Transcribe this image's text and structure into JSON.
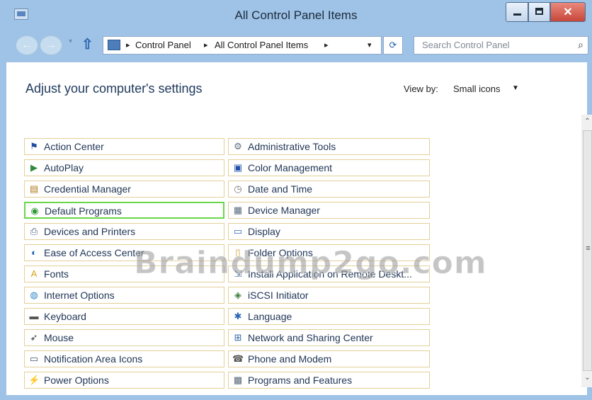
{
  "window": {
    "title": "All Control Panel Items"
  },
  "caption_buttons": {
    "minimize": "–",
    "maximize": "□",
    "close": "✕"
  },
  "nav": {
    "back_glyph": "←",
    "forward_glyph": "→",
    "recent_glyph": "▾",
    "up_glyph": "⇧",
    "breadcrumb": [
      "Control Panel",
      "All Control Panel Items"
    ],
    "breadcrumb_separator": "▸",
    "address_dropdown_glyph": "▾",
    "refresh_glyph": "⟳",
    "search_placeholder": "Search Control Panel",
    "search_glyph": "⌕"
  },
  "page": {
    "heading": "Adjust your computer's settings",
    "view_by_label": "View by:",
    "view_by_value": "Small icons",
    "view_by_arrow": "▼"
  },
  "items": {
    "col1": [
      {
        "label": "Action Center",
        "icon": "flag-icon",
        "glyph": "⚑",
        "color": "#1c4da0"
      },
      {
        "label": "AutoPlay",
        "icon": "autoplay-icon",
        "glyph": "▶",
        "color": "#2f8a3b"
      },
      {
        "label": "Credential Manager",
        "icon": "credential-vault-icon",
        "glyph": "▤",
        "color": "#b07a1e"
      },
      {
        "label": "Default Programs",
        "icon": "default-programs-icon",
        "glyph": "◉",
        "color": "#2f9a35",
        "selected": true
      },
      {
        "label": "Devices and Printers",
        "icon": "printer-icon",
        "glyph": "⎙",
        "color": "#4a6178"
      },
      {
        "label": "Ease of Access Center",
        "icon": "ease-of-access-icon",
        "glyph": "◐",
        "color": "#1f5fb8"
      },
      {
        "label": "Fonts",
        "icon": "fonts-icon",
        "glyph": "A",
        "color": "#d8a21a"
      },
      {
        "label": "Internet Options",
        "icon": "internet-globe-icon",
        "glyph": "◍",
        "color": "#2f86c8"
      },
      {
        "label": "Keyboard",
        "icon": "keyboard-icon",
        "glyph": "▬",
        "color": "#555555"
      },
      {
        "label": "Mouse",
        "icon": "mouse-icon",
        "glyph": "➶",
        "color": "#333333"
      },
      {
        "label": "Notification Area Icons",
        "icon": "notification-area-icon",
        "glyph": "▭",
        "color": "#3e5872"
      },
      {
        "label": "Power Options",
        "icon": "power-options-icon",
        "glyph": "⚡",
        "color": "#3a8d2e"
      }
    ],
    "col2": [
      {
        "label": "Administrative Tools",
        "icon": "admin-tools-icon",
        "glyph": "⚙",
        "color": "#5d6f80"
      },
      {
        "label": "Color Management",
        "icon": "color-management-icon",
        "glyph": "▣",
        "color": "#1f4fa8"
      },
      {
        "label": "Date and Time",
        "icon": "clock-icon",
        "glyph": "◷",
        "color": "#777777"
      },
      {
        "label": "Device Manager",
        "icon": "device-manager-icon",
        "glyph": "▦",
        "color": "#5a6c7d"
      },
      {
        "label": "Display",
        "icon": "display-icon",
        "glyph": "▭",
        "color": "#2b6cc4"
      },
      {
        "label": "Folder Options",
        "icon": "folder-options-icon",
        "glyph": "▯",
        "color": "#c99a2e"
      },
      {
        "label": "Install Application on Remote Deskt...",
        "icon": "remote-install-icon",
        "glyph": "⇲",
        "color": "#4b6e94"
      },
      {
        "label": "iSCSI Initiator",
        "icon": "iscsi-initiator-icon",
        "glyph": "◈",
        "color": "#3b7f3b"
      },
      {
        "label": "Language",
        "icon": "language-icon",
        "glyph": "✱",
        "color": "#2a64b4"
      },
      {
        "label": "Network and Sharing Center",
        "icon": "network-icon",
        "glyph": "⊞",
        "color": "#2f6aa6"
      },
      {
        "label": "Phone and Modem",
        "icon": "phone-modem-icon",
        "glyph": "☎",
        "color": "#555555"
      },
      {
        "label": "Programs and Features",
        "icon": "programs-features-icon",
        "glyph": "▩",
        "color": "#5a6a7a"
      }
    ]
  },
  "scrollbar": {
    "up_glyph": "⌃",
    "grip_glyph": "≡",
    "down_glyph": "⌄"
  },
  "watermark": "Braindump2go.com"
}
